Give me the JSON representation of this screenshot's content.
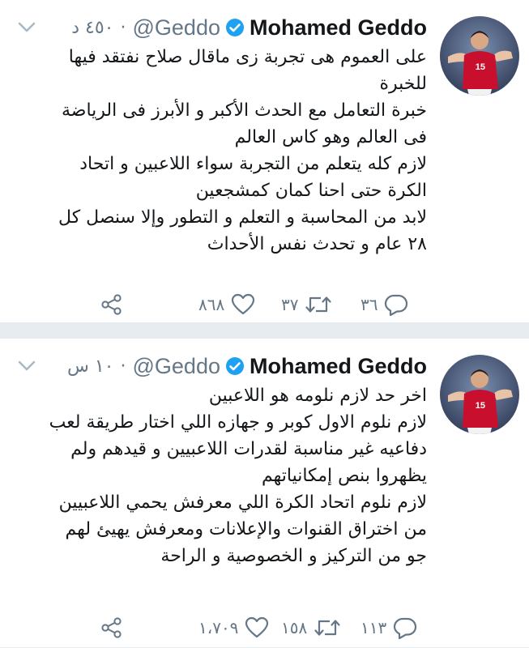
{
  "colors": {
    "text": "#14171a",
    "muted": "#657786",
    "verified": "#1da1f2",
    "divider": "#e6ecf0"
  },
  "tweets": [
    {
      "name": "Mohamed Geddo",
      "handle": "@Geddo",
      "separator": "·",
      "time": "٤٥٠ د",
      "lines": [
        "على العموم هى تجربة زى ماقال صلاح نفتقد فيها",
        "للخبرة",
        "خبرة التعامل مع الحدث الأكبر و الأبرز فى الرياضة",
        "فى العالم وهو كاس العالم",
        "لازم كله يتعلم من التجربة سواء اللاعبين و اتحاد",
        "الكرة حتى احنا كمان كمشجعين",
        "لابد من المحاسبة و التعلم و التطور وإلا سنصل كل",
        "٢٨ عام و تحدث نفس الأحداث"
      ],
      "replies": "٣٦",
      "retweets": "٣٧",
      "likes": "٨٦٨",
      "icons": [
        "reply-icon",
        "retweet-icon",
        "heart-icon",
        "share-icon",
        "verified-badge-icon",
        "chevron-down-icon"
      ]
    },
    {
      "name": "Mohamed Geddo",
      "handle": "@Geddo",
      "separator": "·",
      "time": "١٠ س",
      "lines": [
        "اخر حد لازم نلومه هو اللاعبين",
        "لازم نلوم الاول كوبر و جهازه اللي اختار طريقة لعب",
        "دفاعيه غير مناسبة لقدرات اللاعبيين و قيدهم ولم",
        "يظهروا بنص إمكانياتهم",
        "لازم نلوم اتحاد الكرة اللي معرفش يحمي اللاعبيين",
        "من اختراق القنوات والإعلانات ومعرفش يهيئ لهم",
        "جو من التركيز و الخصوصية و الراحة"
      ],
      "replies": "١١٣",
      "retweets": "١٥٨",
      "likes": "١،٧٠٩",
      "icons": [
        "reply-icon",
        "retweet-icon",
        "heart-icon",
        "share-icon",
        "verified-badge-icon",
        "chevron-down-icon"
      ]
    }
  ]
}
